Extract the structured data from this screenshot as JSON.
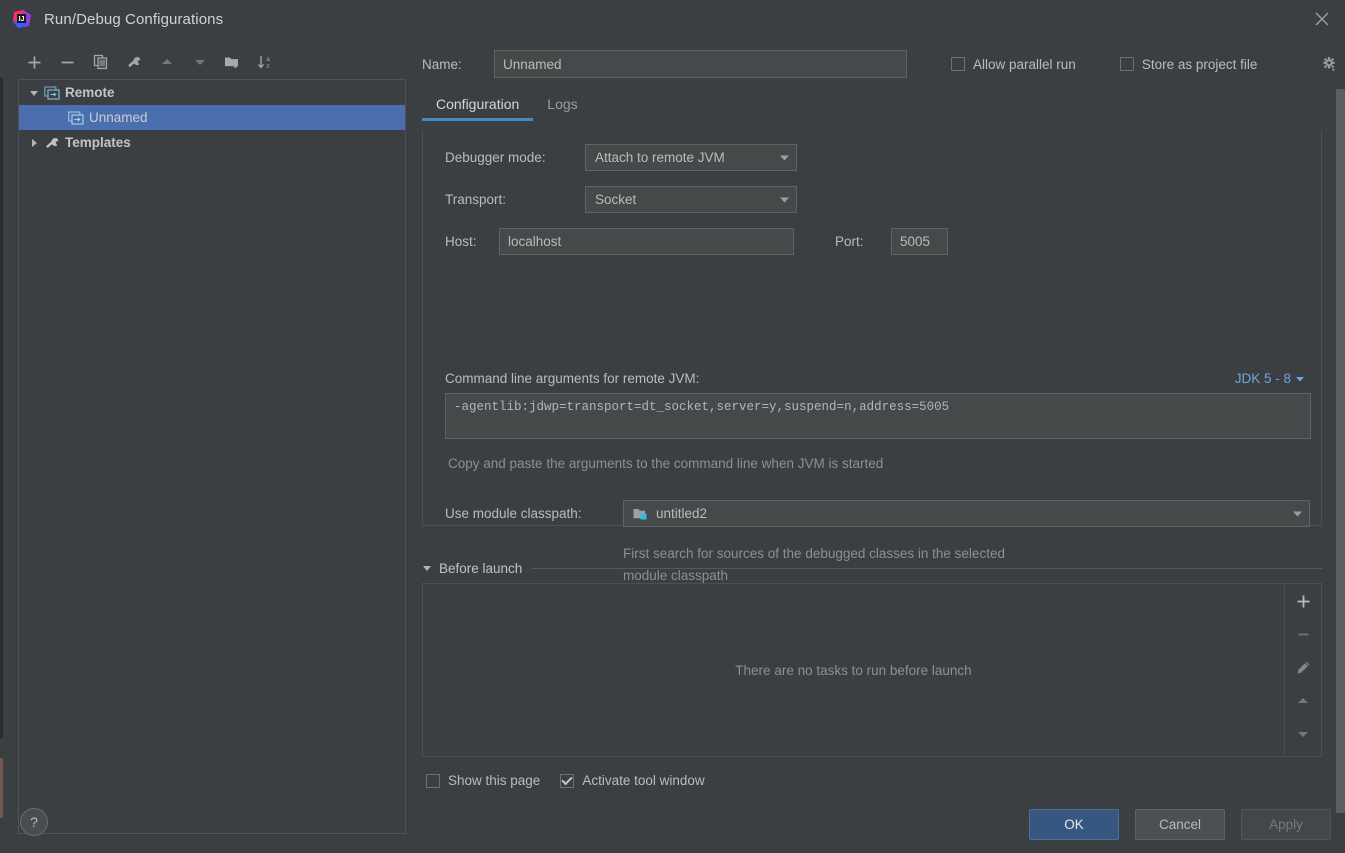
{
  "window": {
    "title": "Run/Debug Configurations",
    "logo_icon": "intellij-idea-logo",
    "close_icon": "close-icon"
  },
  "left_panel": {
    "toolbar": [
      {
        "name": "add",
        "icon": "plus-icon"
      },
      {
        "name": "remove",
        "icon": "minus-icon"
      },
      {
        "name": "copy",
        "icon": "copy-icon"
      },
      {
        "name": "edit-templates",
        "icon": "wrench-icon"
      },
      {
        "name": "move-up",
        "icon": "arrow-up-icon"
      },
      {
        "name": "move-down",
        "icon": "arrow-down-icon"
      },
      {
        "name": "new-folder",
        "icon": "folder-add-icon"
      },
      {
        "name": "sort-alphabetically",
        "icon": "sort-az-icon"
      }
    ],
    "tree": [
      {
        "label": "Remote",
        "icon": "remote-debug-icon",
        "expanded": true,
        "bold": true,
        "level": 0,
        "selected": false
      },
      {
        "label": "Unnamed",
        "icon": "remote-debug-icon",
        "level": 1,
        "selected": true
      },
      {
        "label": "Templates",
        "icon": "wrench-icon",
        "expanded": false,
        "bold": true,
        "level": 0,
        "selected": false
      }
    ],
    "help_button": "?"
  },
  "header": {
    "name_label": "Name:",
    "name_value": "Unnamed",
    "name_placeholder": "Unnamed",
    "allow_parallel_run": {
      "label": "Allow parallel run",
      "checked": false
    },
    "store_as_project_file": {
      "label": "Store as project file",
      "checked": false
    },
    "gear_icon": "gear-dropdown-icon"
  },
  "tabs": [
    {
      "label": "Configuration",
      "active": true
    },
    {
      "label": "Logs",
      "active": false
    }
  ],
  "configuration": {
    "debugger_mode": {
      "label": "Debugger mode:",
      "value": "Attach to remote JVM"
    },
    "transport": {
      "label": "Transport:",
      "value": "Socket"
    },
    "host": {
      "label": "Host:",
      "value": "localhost"
    },
    "port": {
      "label": "Port:",
      "value": "5005"
    },
    "args_label": "Command line arguments for remote JVM:",
    "jdk_selector": "JDK 5 - 8",
    "args_value": "-agentlib:jdwp=transport=dt_socket,server=y,suspend=n,address=5005",
    "args_hint": "Copy and paste the arguments to the command line when JVM is started",
    "module_classpath": {
      "label": "Use module classpath:",
      "value": "untitled2",
      "icon": "module-icon",
      "hint_line_1": "First search for sources of the debugged classes in the selected",
      "hint_line_2": "module classpath"
    }
  },
  "before_launch": {
    "title": "Before launch",
    "expanded": true,
    "empty_text": "There are no tasks to run before launch",
    "toolbar": [
      {
        "name": "add-task",
        "icon": "plus-icon"
      },
      {
        "name": "remove-task",
        "icon": "minus-icon"
      },
      {
        "name": "edit-task",
        "icon": "pencil-icon"
      },
      {
        "name": "move-task-up",
        "icon": "arrow-up-icon"
      },
      {
        "name": "move-task-down",
        "icon": "arrow-down-icon"
      }
    ]
  },
  "footer": {
    "show_this_page": {
      "label": "Show this page",
      "checked": false
    },
    "activate_tool_window": {
      "label": "Activate tool window",
      "checked": true
    },
    "ok": "OK",
    "cancel": "Cancel",
    "apply": "Apply"
  },
  "colors": {
    "background": "#3c3f41",
    "field_background": "#45494a",
    "selection_blue": "#4b6eaf",
    "accent_blue": "#4a88c7",
    "link_blue": "#6ca6e0",
    "primary_button": "#365880",
    "text": "#bbbbbb",
    "hint_text": "#8c9093"
  }
}
